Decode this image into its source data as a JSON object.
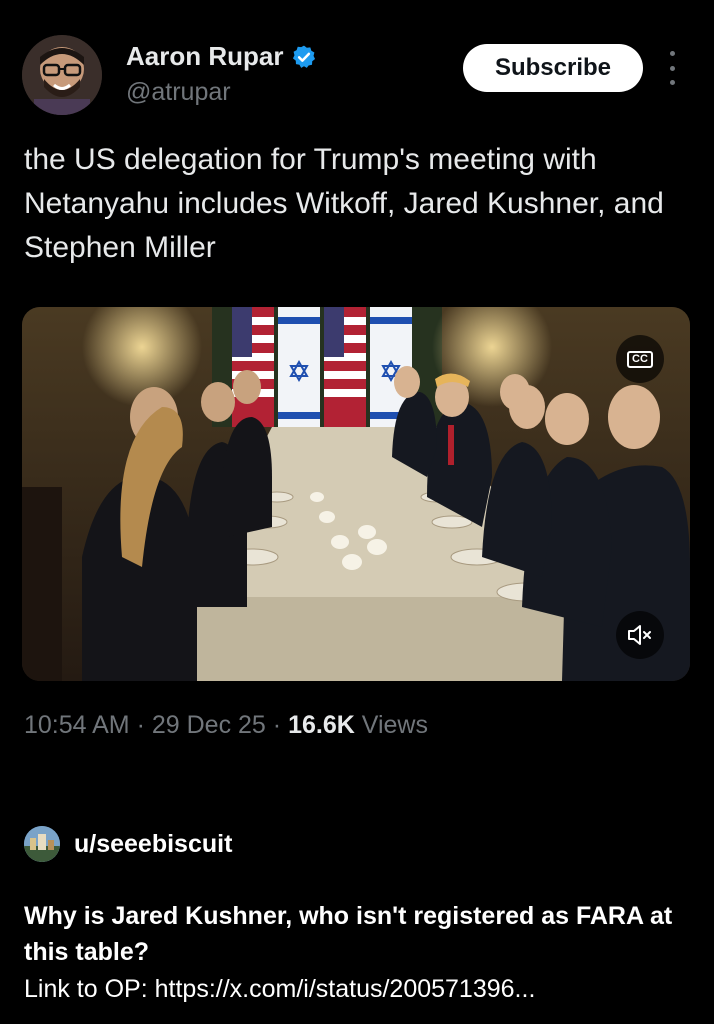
{
  "post": {
    "author_name": "Aaron Rupar",
    "handle": "@atrupar",
    "verified": true,
    "subscribe_label": "Subscribe",
    "text": "the US delegation for Trump's meeting with Netanyahu includes Witkoff, Jared Kushner, and Stephen Miller",
    "media": {
      "captions_label": "CC",
      "muted": true
    },
    "time": "10:54 AM",
    "date": "29 Dec 25",
    "separator": "·",
    "views_count": "16.6K",
    "views_label": "Views"
  },
  "reddit": {
    "username": "u/seeebiscuit",
    "question": "Why is Jared Kushner, who isn't registered as FARA at this table?",
    "link_text": "Link to OP: https://x.com/i/status/200571396..."
  },
  "colors": {
    "background": "#000000",
    "primary_text": "#e7e9ea",
    "secondary_text": "#71767b",
    "verified_blue": "#1d9bf0"
  }
}
